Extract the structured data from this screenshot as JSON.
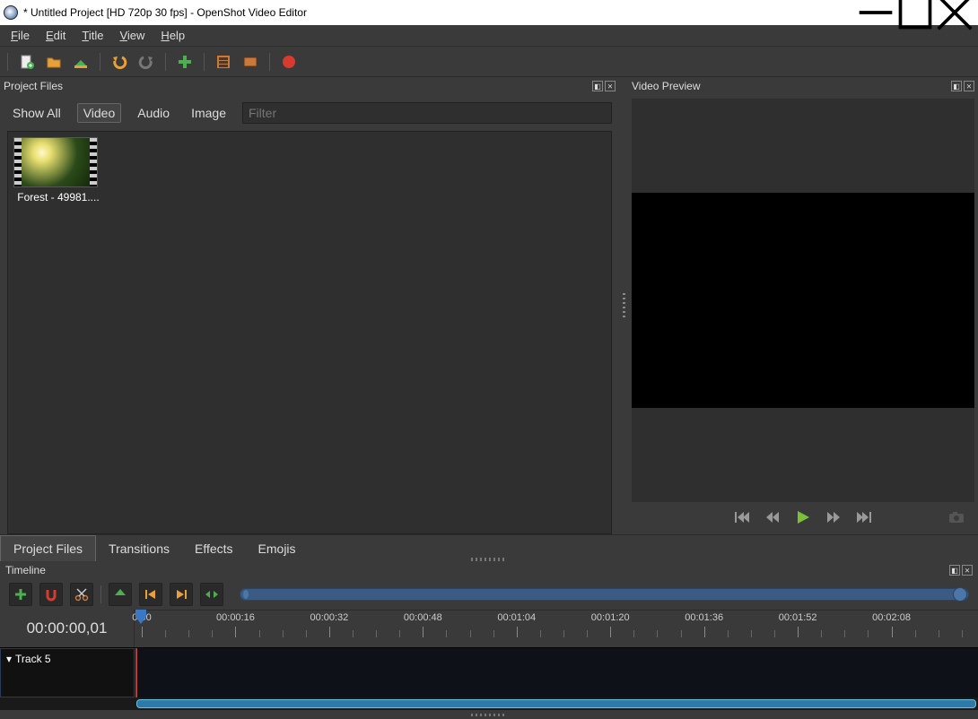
{
  "titlebar": {
    "title": "* Untitled Project [HD 720p 30 fps] - OpenShot Video Editor"
  },
  "menubar": [
    "File",
    "Edit",
    "Title",
    "View",
    "Help"
  ],
  "panes": {
    "projectFiles": "Project Files",
    "videoPreview": "Video Preview",
    "timeline": "Timeline"
  },
  "projectFiles": {
    "filters": {
      "showAll": "Show All",
      "video": "Video",
      "audio": "Audio",
      "image": "Image"
    },
    "filterPlaceholder": "Filter",
    "items": [
      {
        "label": "Forest - 49981...."
      }
    ]
  },
  "bottomTabs": [
    "Project Files",
    "Transitions",
    "Effects",
    "Emojis"
  ],
  "timeline": {
    "timecode": "00:00:00,01",
    "ruler": [
      "0:00",
      "00:00:16",
      "00:00:32",
      "00:00:48",
      "00:01:04",
      "00:01:20",
      "00:01:36",
      "00:01:52",
      "00:02:08"
    ],
    "track": "Track 5"
  }
}
